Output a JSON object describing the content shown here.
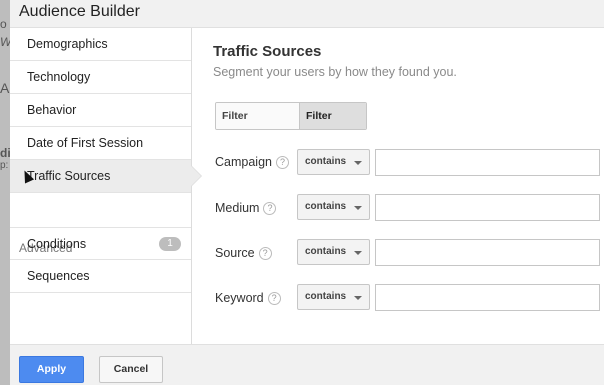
{
  "background": {
    "fragments": [
      "o",
      "W",
      "A",
      "dit",
      "p: c"
    ]
  },
  "dialog": {
    "title": "Audience Builder"
  },
  "sidebar": {
    "items": [
      {
        "label": "Demographics"
      },
      {
        "label": "Technology"
      },
      {
        "label": "Behavior"
      },
      {
        "label": "Date of First Session"
      },
      {
        "label": "Traffic Sources",
        "active": true
      }
    ],
    "advanced_heading": "Advanced",
    "advanced_items": [
      {
        "label": "Conditions",
        "badge": "1"
      },
      {
        "label": "Sequences"
      }
    ]
  },
  "main": {
    "title": "Traffic Sources",
    "subtitle": "Segment your users by how they found you.",
    "toggle": {
      "options": [
        "Filter Sessions",
        "Filter Users"
      ],
      "selected": "Filter Users"
    },
    "filters": [
      {
        "label": "Campaign",
        "operator": "contains",
        "value": ""
      },
      {
        "label": "Medium",
        "operator": "contains",
        "value": ""
      },
      {
        "label": "Source",
        "operator": "contains",
        "value": ""
      },
      {
        "label": "Keyword",
        "operator": "contains",
        "value": ""
      }
    ],
    "help_glyph": "?"
  },
  "footer": {
    "apply_label": "Apply",
    "cancel_label": "Cancel"
  },
  "colors": {
    "primary_button": "#4d8bf0",
    "active_item_bg": "#ececec"
  },
  "icons": [
    "help-icon",
    "chevron-down-icon",
    "mouse-cursor-icon"
  ]
}
